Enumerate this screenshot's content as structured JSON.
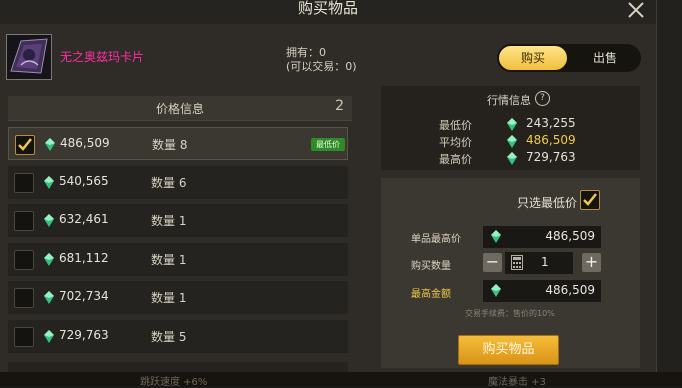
{
  "dialog": {
    "title": "购买物品"
  },
  "item": {
    "name": "无之奥兹玛卡片"
  },
  "ownership": {
    "owned": "拥有：0",
    "tradable": "(可以交易：0)"
  },
  "mode_toggle": {
    "buy": "购买",
    "sell": "出售",
    "active": "buy"
  },
  "price_info": {
    "title": "价格信息",
    "count": "2",
    "lowest_badge": "最低价",
    "rows": [
      {
        "price": "486,509",
        "qty": "数量 8",
        "selected": true,
        "lowest": true
      },
      {
        "price": "540,565",
        "qty": "数量 6",
        "selected": false,
        "lowest": false
      },
      {
        "price": "632,461",
        "qty": "数量 1",
        "selected": false,
        "lowest": false
      },
      {
        "price": "681,112",
        "qty": "数量 1",
        "selected": false,
        "lowest": false
      },
      {
        "price": "702,734",
        "qty": "数量 1",
        "selected": false,
        "lowest": false
      },
      {
        "price": "729,763",
        "qty": "数量 5",
        "selected": false,
        "lowest": false
      }
    ]
  },
  "market": {
    "title": "行情信息",
    "help_glyph": "?",
    "stats": [
      {
        "label": "最低价",
        "value": "243,255"
      },
      {
        "label": "平均价",
        "value": "486,509"
      },
      {
        "label": "最高价",
        "value": "729,763"
      }
    ]
  },
  "purchase": {
    "only_lowest_label": "只选最低价",
    "only_lowest_checked": true,
    "max_unit_price_label": "单品最高价",
    "max_unit_price": "486,509",
    "quantity_label": "购买数量",
    "quantity": "1",
    "max_total_label": "最高金额",
    "max_total": "486,509",
    "fee_note": "交易手续费：售价的10%",
    "buy_button": "购买物品",
    "minus": "−",
    "plus": "+"
  },
  "background": {
    "left_text": "跳跃速度 +6%",
    "right_text": "魔法暴击 +3"
  },
  "colors": {
    "gold_accent": "#f0c94a",
    "item_name": "#ff2ea6",
    "lowest_badge": "#2f8a2a"
  }
}
